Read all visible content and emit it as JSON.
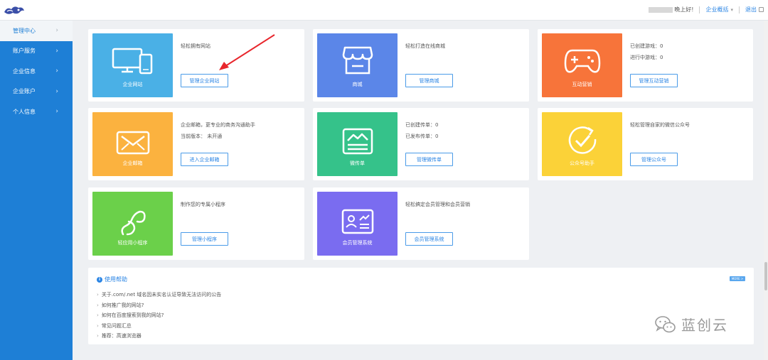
{
  "header": {
    "greeting": "晚上好!",
    "company_menu": "企业概括",
    "logout": "退出"
  },
  "sidebar": {
    "items": [
      {
        "label": "管理中心"
      },
      {
        "label": "账户服务"
      },
      {
        "label": "企业信息"
      },
      {
        "label": "企业账户"
      },
      {
        "label": "个人信息"
      }
    ]
  },
  "cards": {
    "website": {
      "tile": "企业网站",
      "color": "#4ab0e6",
      "info": [
        "轻松拥有网站"
      ],
      "button": "管理企业网站"
    },
    "mall": {
      "tile": "商城",
      "color": "#5b86e8",
      "info": [
        "轻松打造在线商城"
      ],
      "button": "管理商城"
    },
    "game": {
      "tile": "互动营销",
      "color": "#f7743a",
      "info": [
        "已创建游戏：0",
        "进行中游戏：0"
      ],
      "button": "管理互动营销"
    },
    "mail": {
      "tile": "企业邮箱",
      "color": "#fbb23f",
      "info": [
        "企业邮箱，更专业的商务沟通助手",
        "当前版本：  未开通"
      ],
      "button": "进入企业邮箱"
    },
    "flyer": {
      "tile": "微传单",
      "color": "#35c28a",
      "info": [
        "已创建传单：0",
        "已发布传单：0"
      ],
      "button": "管理微传单"
    },
    "wechat": {
      "tile": "公众号助手",
      "color": "#fbd238",
      "info": [
        "轻松管理自家的微信公众号"
      ],
      "button": "管理公众号"
    },
    "miniapp": {
      "tile": "轻应用小程序",
      "color": "#6bd04a",
      "info": [
        "制作您的专属小程序"
      ],
      "button": "管理小程序"
    },
    "member": {
      "tile": "会员管理系统",
      "color": "#7a6cf0",
      "info": [
        "轻松搞定会员管理和会员营销"
      ],
      "button": "会员管理系统"
    }
  },
  "help": {
    "title": "使用帮助",
    "more": "MORE >",
    "items": [
      "关于.com/.net 域名因未实名认证导致无法访问的公告",
      "如何推广我的网站?",
      "如何在百度搜索到我的网站?",
      "常见问题汇总",
      "推荐：高速浏览器"
    ]
  },
  "watermark": {
    "text": "蓝创云"
  }
}
